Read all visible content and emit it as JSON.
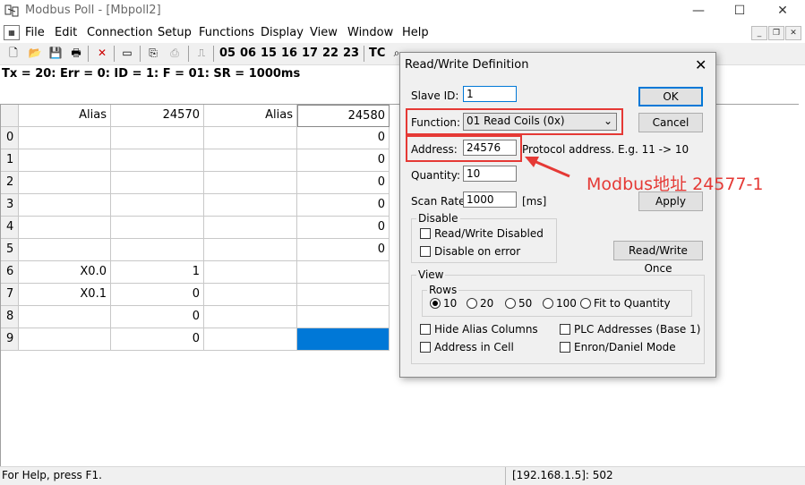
{
  "window": {
    "title": "Modbus Poll - [Mbpoll2]"
  },
  "menu": [
    "File",
    "Edit",
    "Connection",
    "Setup",
    "Functions",
    "Display",
    "View",
    "Window",
    "Help"
  ],
  "toolbar": {
    "codes": [
      "05",
      "06",
      "15",
      "16",
      "17",
      "22",
      "23"
    ],
    "tc": "TC"
  },
  "status_line": "Tx = 20: Err = 0: ID = 1: F = 01: SR = 1000ms",
  "grid": {
    "headers": [
      "Alias",
      "24570",
      "Alias",
      "24580"
    ],
    "rows": [
      {
        "n": "0",
        "a1": "",
        "v1": "",
        "a2": "",
        "v2": "0"
      },
      {
        "n": "1",
        "a1": "",
        "v1": "",
        "a2": "",
        "v2": "0"
      },
      {
        "n": "2",
        "a1": "",
        "v1": "",
        "a2": "",
        "v2": "0"
      },
      {
        "n": "3",
        "a1": "",
        "v1": "",
        "a2": "",
        "v2": "0"
      },
      {
        "n": "4",
        "a1": "",
        "v1": "",
        "a2": "",
        "v2": "0"
      },
      {
        "n": "5",
        "a1": "",
        "v1": "",
        "a2": "",
        "v2": "0"
      },
      {
        "n": "6",
        "a1": "X0.0",
        "v1": "1",
        "a2": "",
        "v2": ""
      },
      {
        "n": "7",
        "a1": "X0.1",
        "v1": "0",
        "a2": "",
        "v2": ""
      },
      {
        "n": "8",
        "a1": "",
        "v1": "0",
        "a2": "",
        "v2": ""
      },
      {
        "n": "9",
        "a1": "",
        "v1": "0",
        "a2": "",
        "v2": ""
      }
    ]
  },
  "dialog": {
    "title": "Read/Write Definition",
    "slave_id_label": "Slave ID:",
    "slave_id": "1",
    "function_label": "Function:",
    "function_value": "01 Read Coils (0x)",
    "address_label": "Address:",
    "address_value": "24576",
    "address_hint": "Protocol address. E.g. 11 -> 10",
    "quantity_label": "Quantity:",
    "quantity_value": "10",
    "scan_rate_label": "Scan Rate:",
    "scan_rate_value": "1000",
    "scan_rate_unit": "[ms]",
    "ok": "OK",
    "cancel": "Cancel",
    "apply": "Apply",
    "disable_group": "Disable",
    "rw_disabled": "Read/Write Disabled",
    "disable_on_error": "Disable on error",
    "rw_once": "Read/Write Once",
    "view_group": "View",
    "rows_group": "Rows",
    "rows_options": [
      "10",
      "20",
      "50",
      "100",
      "Fit to Quantity"
    ],
    "hide_alias": "Hide Alias Columns",
    "address_in_cell": "Address in Cell",
    "plc_addresses": "PLC Addresses (Base 1)",
    "enron": "Enron/Daniel Mode"
  },
  "annotation": {
    "text": "Modbus地址 24577-1",
    "color": "#e53935"
  },
  "statusbar": {
    "help": "For Help, press F1.",
    "conn": "[192.168.1.5]: 502"
  },
  "colors": {
    "selection": "#0078d7",
    "highlight": "#e53935"
  }
}
